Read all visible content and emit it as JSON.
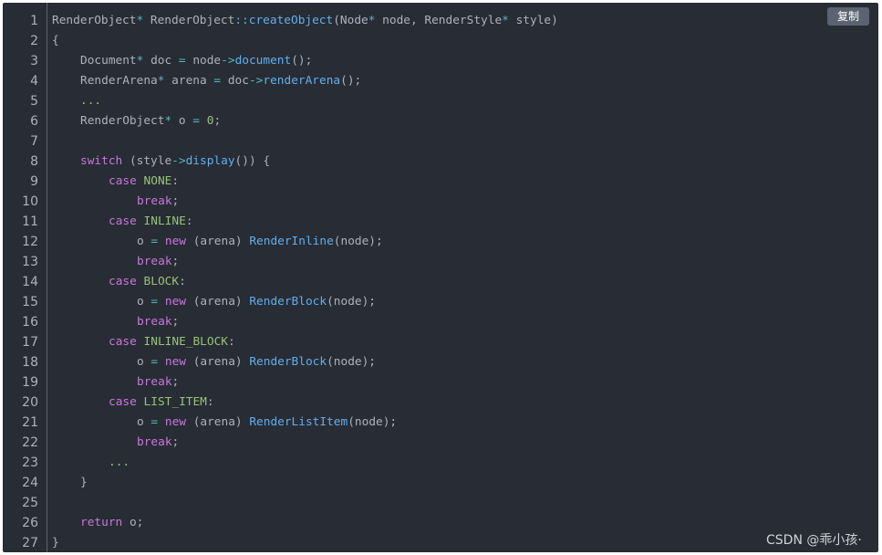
{
  "copy_button": {
    "label": "复制"
  },
  "watermark": {
    "text": "CSDN @乖小孩·"
  },
  "code_lines": [
    {
      "n": "1",
      "indent": 0,
      "tokens": [
        [
          "plain",
          "RenderObject"
        ],
        [
          "op",
          "*"
        ],
        [
          "plain",
          " RenderObject"
        ],
        [
          "op",
          "::"
        ],
        [
          "fn",
          "createObject"
        ],
        [
          "plain",
          "(Node"
        ],
        [
          "op",
          "*"
        ],
        [
          "plain",
          " node, RenderStyle"
        ],
        [
          "op",
          "*"
        ],
        [
          "plain",
          " style)"
        ]
      ]
    },
    {
      "n": "2",
      "indent": 0,
      "tokens": [
        [
          "plain",
          "{"
        ]
      ]
    },
    {
      "n": "3",
      "indent": 1,
      "tokens": [
        [
          "plain",
          "Document"
        ],
        [
          "op",
          "*"
        ],
        [
          "plain",
          " doc "
        ],
        [
          "op",
          "="
        ],
        [
          "plain",
          " node"
        ],
        [
          "op",
          "->"
        ],
        [
          "fn",
          "document"
        ],
        [
          "plain",
          "();"
        ]
      ]
    },
    {
      "n": "4",
      "indent": 1,
      "tokens": [
        [
          "plain",
          "RenderArena"
        ],
        [
          "op",
          "*"
        ],
        [
          "plain",
          " arena "
        ],
        [
          "op",
          "="
        ],
        [
          "plain",
          " doc"
        ],
        [
          "op",
          "->"
        ],
        [
          "fn",
          "renderArena"
        ],
        [
          "plain",
          "();"
        ]
      ]
    },
    {
      "n": "5",
      "indent": 1,
      "tokens": [
        [
          "ph",
          "..."
        ]
      ]
    },
    {
      "n": "6",
      "indent": 1,
      "tokens": [
        [
          "plain",
          "RenderObject"
        ],
        [
          "op",
          "*"
        ],
        [
          "plain",
          " o "
        ],
        [
          "op",
          "="
        ],
        [
          "plain",
          " "
        ],
        [
          "num",
          "0"
        ],
        [
          "plain",
          ";"
        ]
      ]
    },
    {
      "n": "7",
      "indent": 0,
      "tokens": []
    },
    {
      "n": "8",
      "indent": 1,
      "tokens": [
        [
          "kw",
          "switch"
        ],
        [
          "plain",
          " (style"
        ],
        [
          "op",
          "->"
        ],
        [
          "fn",
          "display"
        ],
        [
          "plain",
          "()) {"
        ]
      ]
    },
    {
      "n": "9",
      "indent": 2,
      "tokens": [
        [
          "kw",
          "case"
        ],
        [
          "plain",
          " "
        ],
        [
          "const",
          "NONE"
        ],
        [
          "plain",
          ":"
        ]
      ]
    },
    {
      "n": "10",
      "indent": 3,
      "tokens": [
        [
          "kw",
          "break"
        ],
        [
          "plain",
          ";"
        ]
      ]
    },
    {
      "n": "11",
      "indent": 2,
      "tokens": [
        [
          "kw",
          "case"
        ],
        [
          "plain",
          " "
        ],
        [
          "const",
          "INLINE"
        ],
        [
          "plain",
          ":"
        ]
      ]
    },
    {
      "n": "12",
      "indent": 3,
      "tokens": [
        [
          "plain",
          "o "
        ],
        [
          "op",
          "="
        ],
        [
          "plain",
          " "
        ],
        [
          "kw",
          "new"
        ],
        [
          "plain",
          " (arena) "
        ],
        [
          "fn",
          "RenderInline"
        ],
        [
          "plain",
          "(node);"
        ]
      ]
    },
    {
      "n": "13",
      "indent": 3,
      "tokens": [
        [
          "kw",
          "break"
        ],
        [
          "plain",
          ";"
        ]
      ]
    },
    {
      "n": "14",
      "indent": 2,
      "tokens": [
        [
          "kw",
          "case"
        ],
        [
          "plain",
          " "
        ],
        [
          "const",
          "BLOCK"
        ],
        [
          "plain",
          ":"
        ]
      ]
    },
    {
      "n": "15",
      "indent": 3,
      "tokens": [
        [
          "plain",
          "o "
        ],
        [
          "op",
          "="
        ],
        [
          "plain",
          " "
        ],
        [
          "kw",
          "new"
        ],
        [
          "plain",
          " (arena) "
        ],
        [
          "fn",
          "RenderBlock"
        ],
        [
          "plain",
          "(node);"
        ]
      ]
    },
    {
      "n": "16",
      "indent": 3,
      "tokens": [
        [
          "kw",
          "break"
        ],
        [
          "plain",
          ";"
        ]
      ]
    },
    {
      "n": "17",
      "indent": 2,
      "tokens": [
        [
          "kw",
          "case"
        ],
        [
          "plain",
          " "
        ],
        [
          "const",
          "INLINE_BLOCK"
        ],
        [
          "plain",
          ":"
        ]
      ]
    },
    {
      "n": "18",
      "indent": 3,
      "tokens": [
        [
          "plain",
          "o "
        ],
        [
          "op",
          "="
        ],
        [
          "plain",
          " "
        ],
        [
          "kw",
          "new"
        ],
        [
          "plain",
          " (arena) "
        ],
        [
          "fn",
          "RenderBlock"
        ],
        [
          "plain",
          "(node);"
        ]
      ]
    },
    {
      "n": "19",
      "indent": 3,
      "tokens": [
        [
          "kw",
          "break"
        ],
        [
          "plain",
          ";"
        ]
      ]
    },
    {
      "n": "20",
      "indent": 2,
      "tokens": [
        [
          "kw",
          "case"
        ],
        [
          "plain",
          " "
        ],
        [
          "const",
          "LIST_ITEM"
        ],
        [
          "plain",
          ":"
        ]
      ]
    },
    {
      "n": "21",
      "indent": 3,
      "tokens": [
        [
          "plain",
          "o "
        ],
        [
          "op",
          "="
        ],
        [
          "plain",
          " "
        ],
        [
          "kw",
          "new"
        ],
        [
          "plain",
          " (arena) "
        ],
        [
          "fn",
          "RenderListItem"
        ],
        [
          "plain",
          "(node);"
        ]
      ]
    },
    {
      "n": "22",
      "indent": 3,
      "tokens": [
        [
          "kw",
          "break"
        ],
        [
          "plain",
          ";"
        ]
      ]
    },
    {
      "n": "23",
      "indent": 2,
      "tokens": [
        [
          "ph",
          "..."
        ]
      ]
    },
    {
      "n": "24",
      "indent": 1,
      "tokens": [
        [
          "plain",
          "}"
        ]
      ]
    },
    {
      "n": "25",
      "indent": 0,
      "tokens": []
    },
    {
      "n": "26",
      "indent": 1,
      "tokens": [
        [
          "kw",
          "return"
        ],
        [
          "plain",
          " o;"
        ]
      ]
    },
    {
      "n": "27",
      "indent": 0,
      "tokens": [
        [
          "plain",
          "}"
        ]
      ]
    }
  ]
}
